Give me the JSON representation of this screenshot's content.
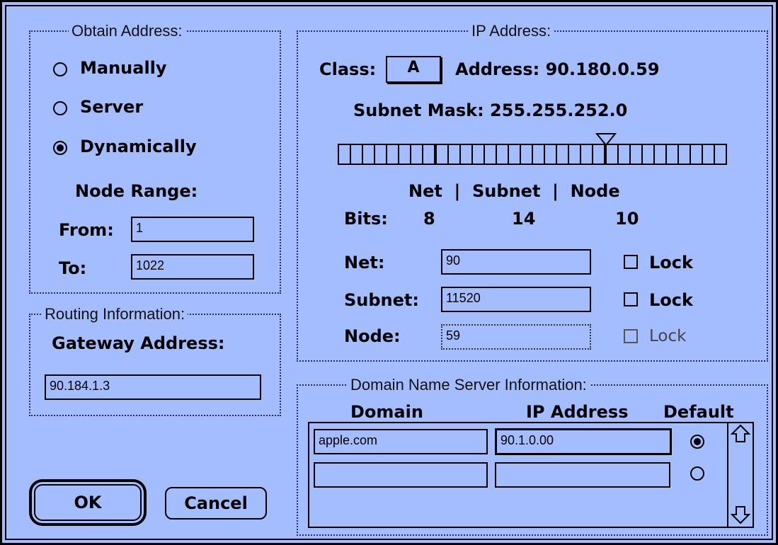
{
  "obtain": {
    "title": "Obtain Address:",
    "options": [
      {
        "label": "Manually",
        "selected": false
      },
      {
        "label": "Server",
        "selected": false
      },
      {
        "label": "Dynamically",
        "selected": true
      }
    ],
    "node_range_label": "Node Range:",
    "from_label": "From:",
    "from_value": "1",
    "to_label": "To:",
    "to_value": "1022"
  },
  "routing": {
    "title": "Routing Information:",
    "gateway_label": "Gateway Address:",
    "gateway_value": "90.184.1.3"
  },
  "ip": {
    "title": "IP Address:",
    "class_label": "Class:",
    "class_value": "A",
    "address_text": "Address: 90.180.0.59",
    "subnet_mask_text": "Subnet Mask: 255.255.252.0",
    "bit_columns": "Net  |  Subnet  |  Node",
    "bits_label": "Bits:",
    "bits": {
      "net": "8",
      "subnet": "14",
      "node": "10"
    },
    "net_label": "Net:",
    "net_value": "90",
    "subnet_label": "Subnet:",
    "subnet_value": "11520",
    "node_label": "Node:",
    "node_value": "59",
    "lock_label": "Lock"
  },
  "dns": {
    "title": "Domain Name Server Information:",
    "col_domain": "Domain",
    "col_ip": "IP Address",
    "col_default": "Default",
    "rows": [
      {
        "domain": "apple.com",
        "ip": "90.1.0.00",
        "default": true
      },
      {
        "domain": "",
        "ip": "",
        "default": false
      }
    ]
  },
  "buttons": {
    "ok": "OK",
    "cancel": "Cancel"
  },
  "colors": {
    "background": "#a4bdff",
    "ink": "#000000"
  }
}
